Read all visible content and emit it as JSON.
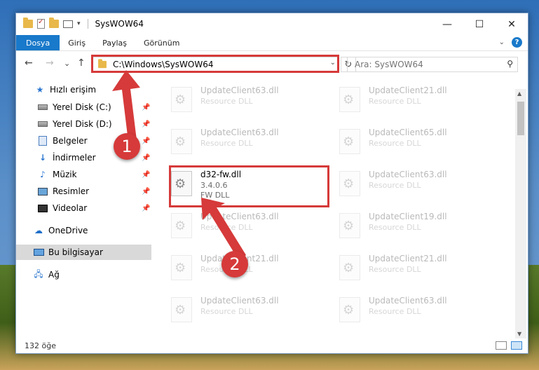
{
  "window": {
    "title": "SysWOW64",
    "controls": {
      "minimize": "—",
      "maximize": "☐",
      "close": "✕"
    }
  },
  "ribbon": {
    "tabs": [
      {
        "label": "Dosya",
        "active": true
      },
      {
        "label": "Giriş"
      },
      {
        "label": "Paylaş"
      },
      {
        "label": "Görünüm"
      }
    ],
    "help": "?"
  },
  "nav": {
    "back": "←",
    "forward": "→",
    "recent": "⌄",
    "up": "↑",
    "address": "C:\\Windows\\SysWOW64",
    "refresh": "↻",
    "search_placeholder": "Ara: SysWOW64"
  },
  "sidebar": {
    "items": [
      {
        "label": "Hızlı erişim",
        "icon": "star-icon"
      },
      {
        "label": "Yerel Disk (C:)",
        "icon": "disk-icon",
        "pinned": true
      },
      {
        "label": "Yerel Disk (D:)",
        "icon": "disk-icon",
        "pinned": true
      },
      {
        "label": "Belgeler",
        "icon": "documents-icon",
        "pinned": true
      },
      {
        "label": "İndirmeler",
        "icon": "download-icon",
        "pinned": true
      },
      {
        "label": "Müzik",
        "icon": "music-icon",
        "pinned": true
      },
      {
        "label": "Resimler",
        "icon": "pictures-icon",
        "pinned": true
      },
      {
        "label": "Videolar",
        "icon": "videos-icon",
        "pinned": true
      },
      {
        "label": "OneDrive",
        "icon": "cloud-icon"
      },
      {
        "label": "Bu bilgisayar",
        "icon": "computer-icon",
        "selected": true
      },
      {
        "label": "Ağ",
        "icon": "network-icon"
      }
    ]
  },
  "files": [
    {
      "name": "UpdateClient63.dll",
      "line2": "Resource DLL",
      "faded": true
    },
    {
      "name": "UpdateClient21.dll",
      "line2": "Resource DLL",
      "faded": true
    },
    {
      "name": "UpdateClient63.dll",
      "line2": "Resource DLL",
      "faded": true
    },
    {
      "name": "UpdateClient65.dll",
      "line2": "Resource DLL",
      "faded": true
    },
    {
      "name": "d32-fw.dll",
      "line2": "3.4.0.6",
      "line3": "FW DLL",
      "faded": false
    },
    {
      "name": "UpdateClient63.dll",
      "line2": "Resource DLL",
      "faded": true
    },
    {
      "name": "UpdateClient63.dll",
      "line2": "Resource DLL",
      "faded": true
    },
    {
      "name": "UpdateClient19.dll",
      "line2": "Resource DLL",
      "faded": true
    },
    {
      "name": "UpdateClient21.dll",
      "line2": "Resource DLL",
      "faded": true
    },
    {
      "name": "UpdateClient21.dll",
      "line2": "Resource DLL",
      "faded": true
    },
    {
      "name": "UpdateClient63.dll",
      "line2": "Resource DLL",
      "faded": true
    },
    {
      "name": "UpdateClient63.dll",
      "line2": "Resource DLL",
      "faded": true
    }
  ],
  "status": {
    "count": "132 öğe"
  },
  "annotations": {
    "step1": "1",
    "step2": "2",
    "color": "#d63a3a"
  }
}
